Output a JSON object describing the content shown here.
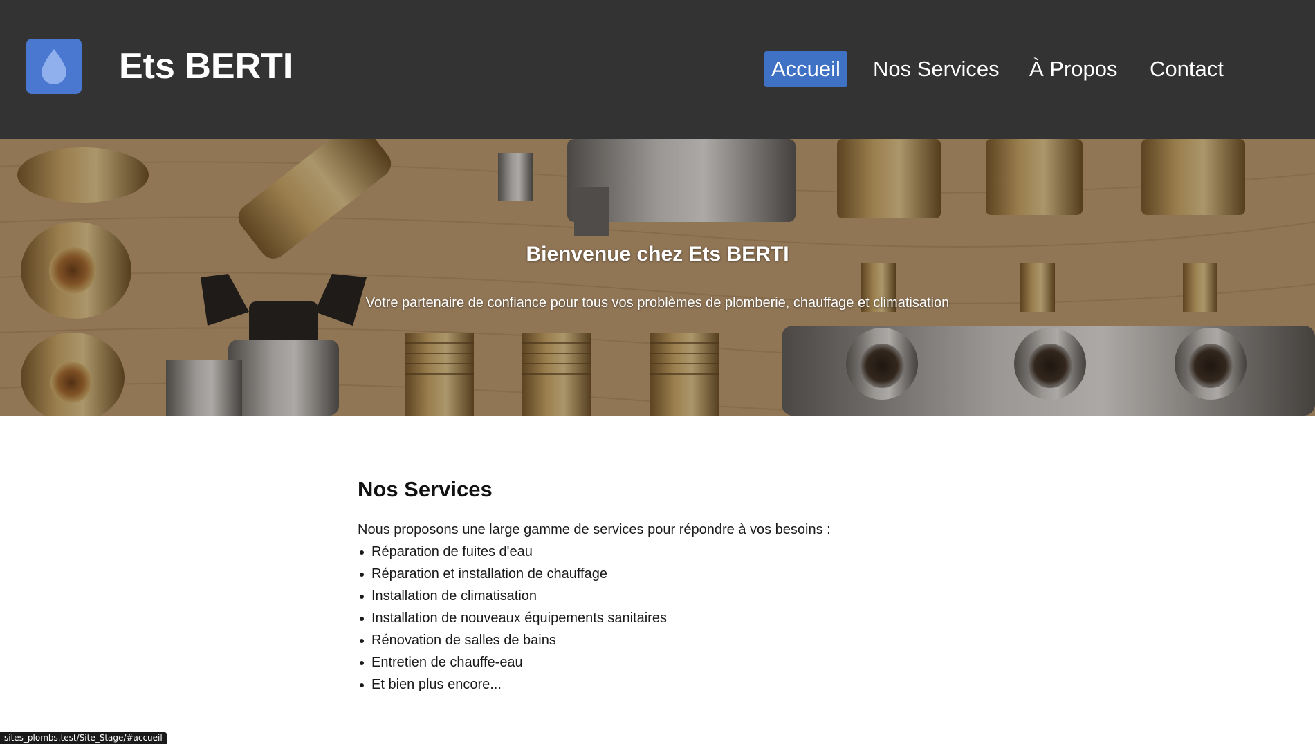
{
  "header": {
    "brand": "Ets BERTI",
    "logo_icon": "water-drop-icon",
    "nav": [
      {
        "label": "Accueil",
        "active": true
      },
      {
        "label": "Nos Services",
        "active": false
      },
      {
        "label": "À Propos",
        "active": false
      },
      {
        "label": "Contact",
        "active": false
      }
    ]
  },
  "hero": {
    "title": "Bienvenue chez Ets BERTI",
    "subtitle": "Votre partenaire de confiance pour tous vos problèmes de plomberie, chauffage et climatisation"
  },
  "services": {
    "heading": "Nos Services",
    "intro": "Nous proposons une large gamme de services pour répondre à vos besoins :",
    "items": [
      "Réparation de fuites d'eau",
      "Réparation et installation de chauffage",
      "Installation de climatisation",
      "Installation de nouveaux équipements sanitaires",
      "Rénovation de salles de bains",
      "Entretien de chauffe-eau",
      "Et bien plus encore..."
    ]
  },
  "statusbar": {
    "url": "sites_plombs.test/Site_Stage/#accueil"
  },
  "colors": {
    "header_bg": "#333333",
    "accent": "#3f72c4",
    "logo_bg": "#4a78d0"
  }
}
